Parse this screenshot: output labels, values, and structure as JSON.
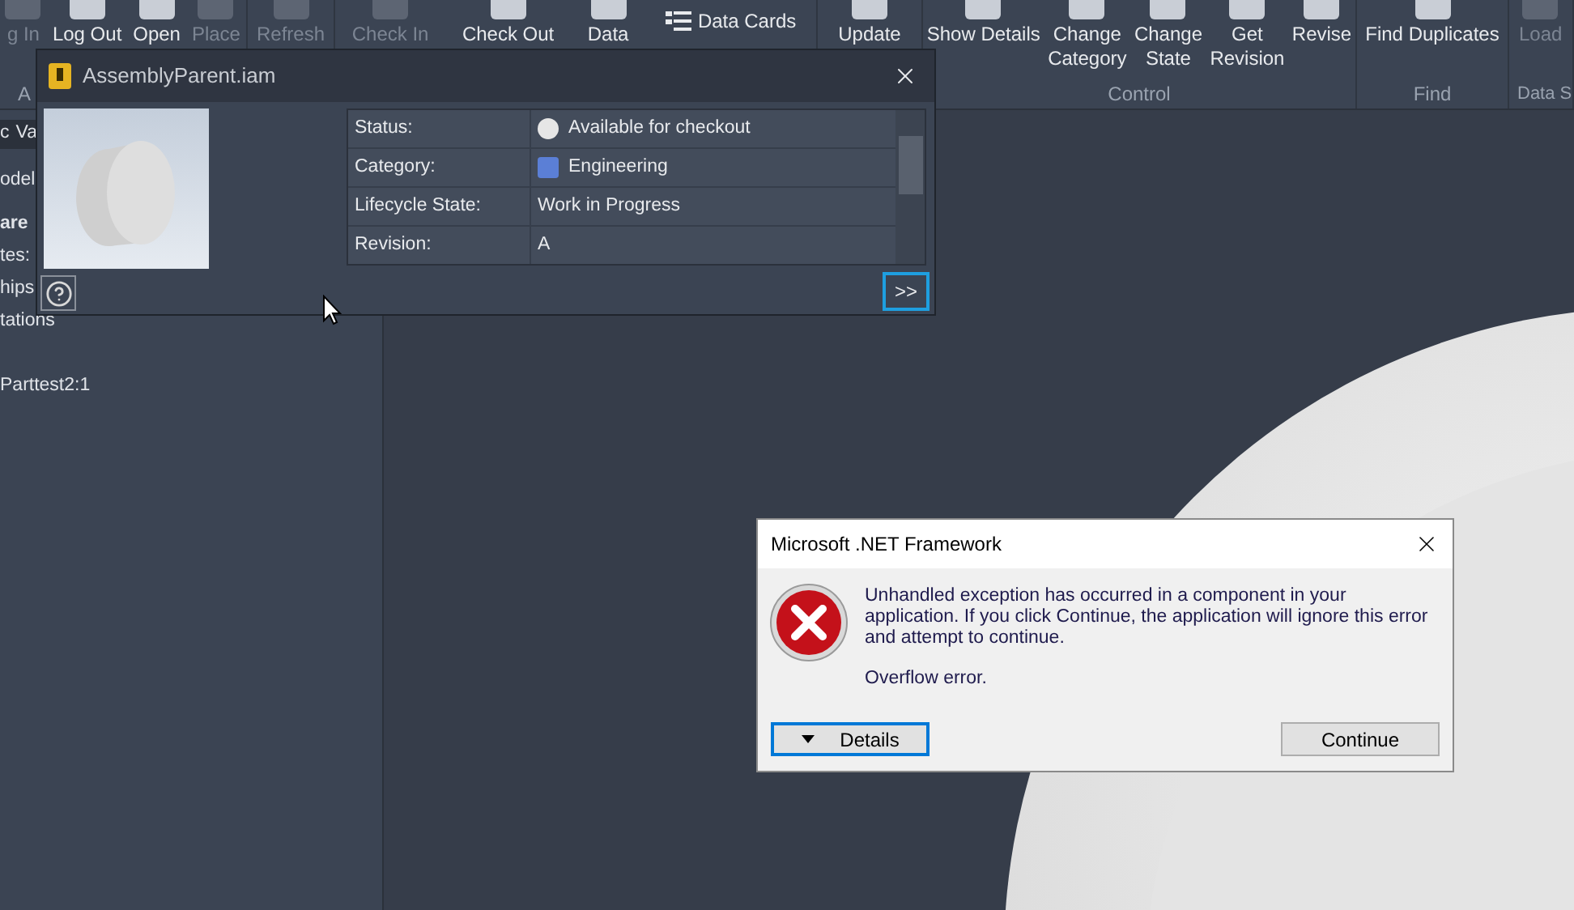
{
  "ribbon": {
    "groups": [
      {
        "label": "A",
        "buttons": [
          {
            "label": "g In",
            "disabled": true
          },
          {
            "label": "Log Out",
            "disabled": false
          },
          {
            "label": "Open",
            "disabled": false
          },
          {
            "label": "Place",
            "disabled": true
          }
        ]
      },
      {
        "buttons": [
          {
            "label": "Refresh",
            "disabled": true
          }
        ]
      },
      {
        "buttons": [
          {
            "label": "Check In",
            "disabled": true
          },
          {
            "label": "Check Out",
            "disabled": false
          },
          {
            "label": "Data",
            "disabled": false
          },
          {
            "label": "Data Cards",
            "disabled": false,
            "kind": "small"
          }
        ]
      },
      {
        "buttons": [
          {
            "label": "Update",
            "disabled": false
          }
        ]
      },
      {
        "label": "Control",
        "buttons": [
          {
            "label": "Show Details",
            "disabled": false
          },
          {
            "label": "Change\nCategory",
            "disabled": false
          },
          {
            "label": "Change\nState",
            "disabled": false
          },
          {
            "label": "Get\nRevision",
            "disabled": false
          },
          {
            "label": "Revise",
            "disabled": false
          }
        ]
      },
      {
        "label": "Find",
        "buttons": [
          {
            "label": "Find Duplicates",
            "disabled": false
          }
        ]
      },
      {
        "label": "Data S",
        "buttons": [
          {
            "label": "Load",
            "disabled": true
          }
        ]
      }
    ]
  },
  "browser": {
    "tabs": [
      "c",
      "Va"
    ],
    "lines": [
      {
        "text": "odel",
        "bold": false
      },
      {
        "text": "are",
        "bold": true
      },
      {
        "text": "tes:",
        "bold": false
      },
      {
        "text": "hips",
        "bold": false
      },
      {
        "text": "tations",
        "bold": false
      },
      {
        "text": "Parttest2:1",
        "bold": false
      }
    ]
  },
  "popup": {
    "title": "AssemblyParent.iam",
    "properties": [
      {
        "label": "Status:",
        "value": "Available for checkout",
        "kind": "status",
        "color": "#e6e6e6"
      },
      {
        "label": "Category:",
        "value": "Engineering",
        "kind": "category",
        "color": "#5b7fd6"
      },
      {
        "label": "Lifecycle State:",
        "value": "Work in Progress",
        "kind": "text"
      },
      {
        "label": "Revision:",
        "value": "A",
        "kind": "text"
      }
    ],
    "expand_button": ">>"
  },
  "dialog": {
    "title": "Microsoft .NET Framework",
    "message": "Unhandled exception has occurred in a component in your application. If you click Continue, the application will ignore this error and attempt to continue.",
    "error": "Overflow error.",
    "buttons": [
      {
        "label": "Details",
        "kind": "details",
        "focused": true
      },
      {
        "label": "Continue",
        "kind": "plain",
        "focused": false
      }
    ]
  }
}
